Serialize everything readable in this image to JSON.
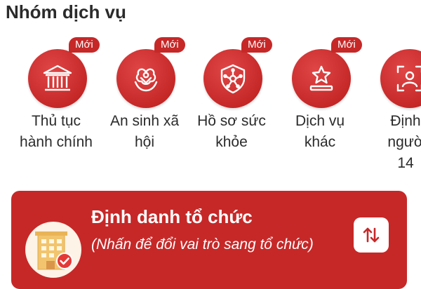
{
  "section": {
    "title": "Nhóm dịch vụ"
  },
  "services": [
    {
      "badge": "Mới",
      "label_lines": [
        "Thủ tục",
        "hành chính"
      ],
      "icon": "courthouse-icon"
    },
    {
      "badge": "Mới",
      "label_lines": [
        "An sinh xã",
        "hội"
      ],
      "icon": "social-care-icon"
    },
    {
      "badge": "Mới",
      "label_lines": [
        "Hồ sơ sức",
        "khỏe"
      ],
      "icon": "health-shield-icon"
    },
    {
      "badge": "Mới",
      "label_lines": [
        "Dịch vụ",
        "khác"
      ],
      "icon": "star-podium-icon"
    },
    {
      "badge": "",
      "label_lines": [
        "Định",
        "ngườ",
        "14"
      ],
      "icon": "face-id-icon"
    }
  ],
  "org_card": {
    "title": "Định danh tổ chức",
    "subtitle": "(Nhấn để đổi vai trò sang tổ chức)",
    "icon": "office-building-icon",
    "switch_icon": "swap-vertical-icon"
  },
  "colors": {
    "brand_red": "#c62828",
    "avatar_bg": "#fdf3e6",
    "text": "#2b2b2b"
  }
}
